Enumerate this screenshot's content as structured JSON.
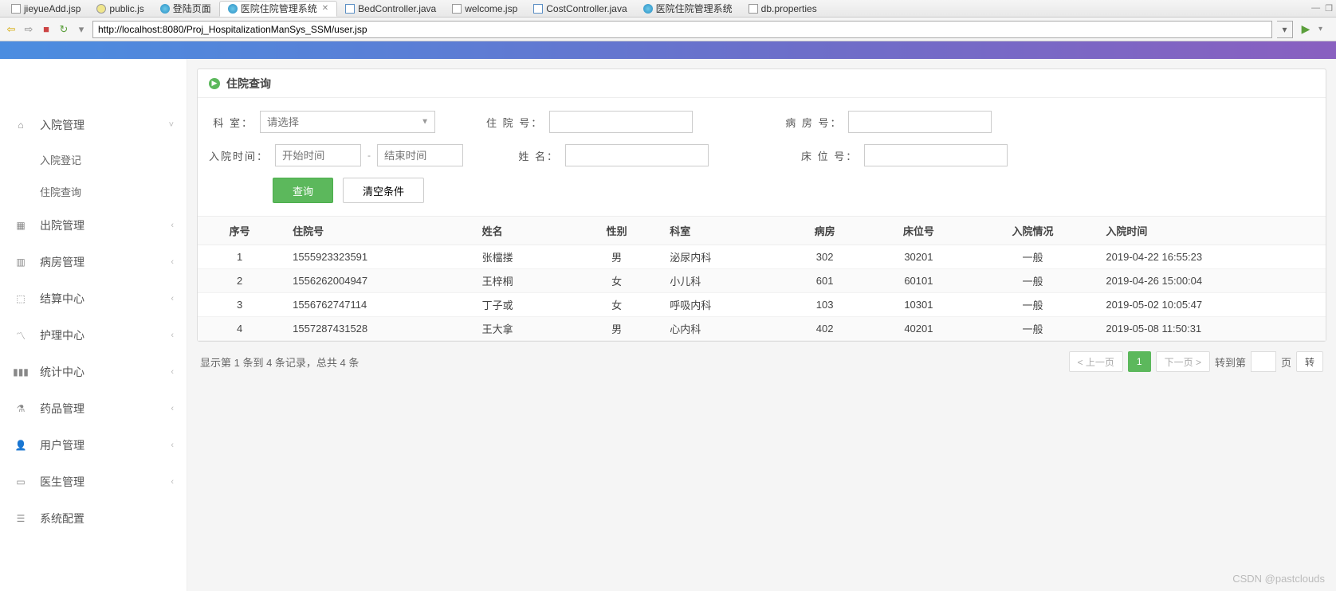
{
  "tabs": [
    {
      "label": "jieyueAdd.jsp",
      "icon": "jsp"
    },
    {
      "label": "public.js",
      "icon": "js"
    },
    {
      "label": "登陆页面",
      "icon": "web"
    },
    {
      "label": "医院住院管理系统",
      "icon": "web",
      "active": true,
      "closable": true
    },
    {
      "label": "BedController.java",
      "icon": "java"
    },
    {
      "label": "welcome.jsp",
      "icon": "jsp"
    },
    {
      "label": "CostController.java",
      "icon": "java"
    },
    {
      "label": "医院住院管理系统",
      "icon": "web"
    },
    {
      "label": "db.properties",
      "icon": "prop"
    }
  ],
  "url": "http://localhost:8080/Proj_HospitalizationManSys_SSM/user.jsp",
  "sidebar": {
    "items": [
      {
        "label": "入院管理",
        "icon": "home",
        "expanded": true,
        "chevron": "˅",
        "children": [
          {
            "label": "入院登记"
          },
          {
            "label": "住院查询"
          }
        ]
      },
      {
        "label": "出院管理",
        "icon": "calendar",
        "chevron": "‹"
      },
      {
        "label": "病房管理",
        "icon": "building",
        "chevron": "‹"
      },
      {
        "label": "结算中心",
        "icon": "map",
        "chevron": "‹"
      },
      {
        "label": "护理中心",
        "icon": "chart-line",
        "chevron": "‹"
      },
      {
        "label": "统计中心",
        "icon": "bar-chart",
        "chevron": "‹"
      },
      {
        "label": "药品管理",
        "icon": "flask",
        "chevron": "‹"
      },
      {
        "label": "用户管理",
        "icon": "user",
        "chevron": "‹"
      },
      {
        "label": "医生管理",
        "icon": "id-card",
        "chevron": "‹"
      },
      {
        "label": "系统配置",
        "icon": "settings"
      }
    ]
  },
  "panel": {
    "title": "住院查询",
    "form": {
      "dept_label": "科    室：",
      "dept_placeholder": "请选择",
      "hospno_label": "住 院 号：",
      "ward_label": "病 房 号：",
      "admit_time_label": "入院时间：",
      "start_placeholder": "开始时间",
      "end_placeholder": "结束时间",
      "name_label": "姓    名：",
      "bed_label": "床 位 号：",
      "query_btn": "查询",
      "clear_btn": "清空条件"
    },
    "table": {
      "headers": [
        "序号",
        "住院号",
        "姓名",
        "性别",
        "科室",
        "病房",
        "床位号",
        "入院情况",
        "入院时间"
      ],
      "rows": [
        [
          "1",
          "1555923323591",
          "张檔搂",
          "男",
          "泌尿内科",
          "302",
          "30201",
          "一般",
          "2019-04-22 16:55:23"
        ],
        [
          "2",
          "1556262004947",
          "王梓桐",
          "女",
          "小儿科",
          "601",
          "60101",
          "一般",
          "2019-04-26 15:00:04"
        ],
        [
          "3",
          "1556762747114",
          "丁子或",
          "女",
          "呼吸内科",
          "103",
          "10301",
          "一般",
          "2019-05-02 10:05:47"
        ],
        [
          "4",
          "1557287431528",
          "王大拿",
          "男",
          "心内科",
          "402",
          "40201",
          "一般",
          "2019-05-08 11:50:31"
        ]
      ]
    },
    "footer": {
      "info": "显示第 1 条到 4 条记录，总共 4 条",
      "prev": "< 上一页",
      "page": "1",
      "next": "下一页 >",
      "jump_label": "转到第",
      "page_unit": "页",
      "jump_btn": "转"
    }
  },
  "watermark": "CSDN @pastclouds"
}
